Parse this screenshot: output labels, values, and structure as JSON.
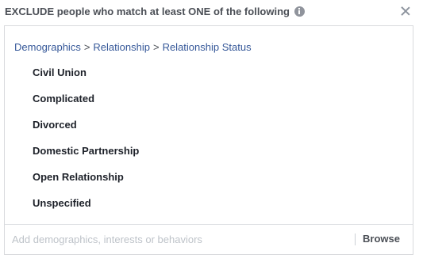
{
  "header": {
    "title": "EXCLUDE people who match at least ONE of the following",
    "info_icon": "info-icon",
    "close_icon": "close-icon"
  },
  "breadcrumb": {
    "items": [
      "Demographics",
      "Relationship",
      "Relationship Status"
    ],
    "separator": ">"
  },
  "selections": [
    "Civil Union",
    "Complicated",
    "Divorced",
    "Domestic Partnership",
    "Open Relationship",
    "Unspecified"
  ],
  "search": {
    "value": "",
    "placeholder": "Add demographics, interests or behaviors"
  },
  "browse_label": "Browse",
  "colors": {
    "link": "#365899",
    "text": "#1d2129",
    "muted": "#4b4f56",
    "border": "#d9dadd",
    "placeholder": "#bec3c9"
  }
}
